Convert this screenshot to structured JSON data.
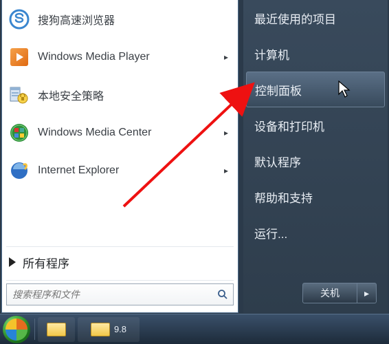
{
  "left": {
    "programs": [
      {
        "label": "搜狗高速浏览器",
        "icon": "sogou",
        "has_submenu": false
      },
      {
        "label": "Windows Media Player",
        "icon": "wmp",
        "has_submenu": true
      },
      {
        "label": "本地安全策略",
        "icon": "secpol",
        "has_submenu": false
      },
      {
        "label": "Windows Media Center",
        "icon": "wmc",
        "has_submenu": true
      },
      {
        "label": "Internet Explorer",
        "icon": "ie",
        "has_submenu": true
      }
    ],
    "all_programs_label": "所有程序",
    "search_placeholder": "搜索程序和文件"
  },
  "right": {
    "items": [
      {
        "label": "最近使用的项目",
        "highlight": false
      },
      {
        "label": "计算机",
        "highlight": false
      },
      {
        "label": "控制面板",
        "highlight": true
      },
      {
        "label": "设备和打印机",
        "highlight": false
      },
      {
        "label": "默认程序",
        "highlight": false
      },
      {
        "label": "帮助和支持",
        "highlight": false
      },
      {
        "label": "运行...",
        "highlight": false
      }
    ],
    "shutdown_label": "关机"
  },
  "taskbar": {
    "active_label": "9.8"
  }
}
